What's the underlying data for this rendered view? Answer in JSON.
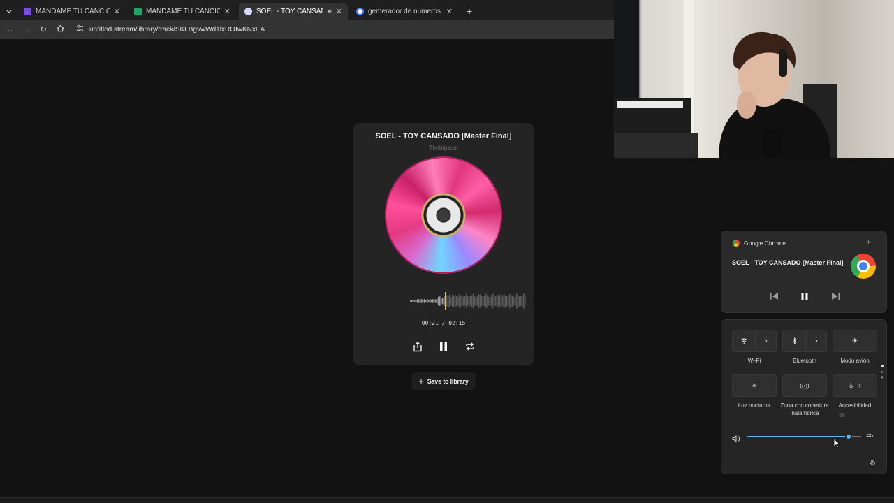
{
  "browser": {
    "tabs": [
      {
        "title": "MANDAME TU CANCION - For",
        "favicon_color": "#7b4ce0"
      },
      {
        "title": "MANDAME TU CANCION (resp",
        "favicon_color": "#21a464"
      },
      {
        "title": "SOEL - TOY CANSADO [Ma",
        "favicon_color": "#d9d9ff"
      },
      {
        "title": "gemerador de numeros aleator",
        "favicon_color": "#ffffff"
      }
    ],
    "new_tab_label": "+",
    "url": "untitled.stream/library/track/SKLBgvwWd1lxROIwKNxEA"
  },
  "player": {
    "title": "SOEL - TOY CANSADO [Master Final]",
    "artist": "Thebigsoel",
    "time": "00:21 / 02:15",
    "progress": 0.156,
    "save_label": "Save to library"
  },
  "media_flyout": {
    "app": "Google Chrome",
    "track": "SOEL - TOY CANSADO [Master Final]"
  },
  "quick_settings": {
    "tiles": [
      {
        "label": "Wi-Fi",
        "icon": "wifi-icon"
      },
      {
        "label": "Bluetooth",
        "icon": "bluetooth-icon"
      },
      {
        "label": "Modo avión",
        "icon": "airplane-icon"
      },
      {
        "label": "Luz nocturna",
        "icon": "brightness-icon"
      },
      {
        "label": "Zona con cobertura inalámbrica",
        "icon": "hotspot-icon"
      },
      {
        "label": "Accesibilidad",
        "icon": "accessibility-icon"
      }
    ],
    "volume_tooltip": "89",
    "volume_level": 0.89
  }
}
